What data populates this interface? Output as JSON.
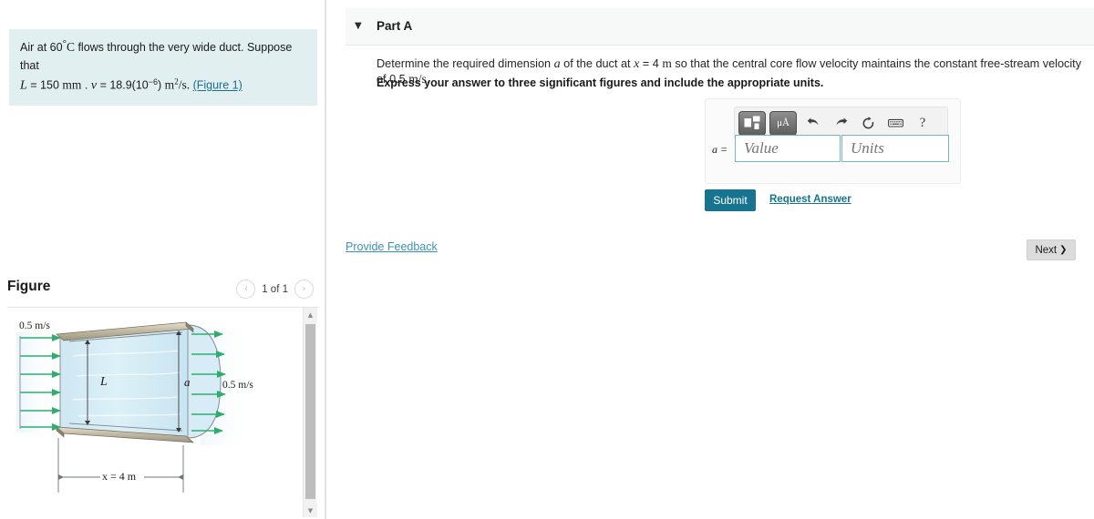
{
  "problem": {
    "line1_a": "Air at 60",
    "line1_deg": "°",
    "line1_c": "C",
    "line1_b": " flows through the very wide duct. Suppose that",
    "var_L": "L",
    "eq1": "= 150",
    "unit_mm": "mm",
    "dot": ".",
    "var_nu": "ν",
    "eq2": "= 18.9(10",
    "exp": "−6",
    "paren": ")",
    "unit_m2s": "m",
    "sup2": "2",
    "per_s": "/s.",
    "figure_link": "(Figure 1)"
  },
  "figure_panel": {
    "title": "Figure",
    "pager_label": "1 of 1",
    "prev_icon": "chevron-left-icon",
    "next_icon": "chevron-right-icon",
    "prev_glyph": "‹",
    "next_glyph": "›",
    "scroll_up_glyph": "▲",
    "scroll_down_glyph": "▼"
  },
  "diagram": {
    "inlet_velocity": "0.5 m/s",
    "outlet_velocity": "0.5 m/s",
    "label_L": "L",
    "label_a": "a",
    "label_x": "x = 4 m",
    "arrow_color": "#2eae6d",
    "fluid_color": "#d8ecf5",
    "wall_color": "#bdb49f"
  },
  "part": {
    "caret_glyph": "▼",
    "caret_icon": "chevron-down-icon",
    "label": "Part A",
    "question": "Determine the required dimension a of the duct at x = 4 m so that the central core flow velocity maintains the constant free-stream velocity of 0.5 m/s.",
    "question_pre": "Determine the required dimension ",
    "question_var_a": "a",
    "question_mid1": " of the duct at ",
    "question_var_x": "x",
    "question_mid2": " = 4 ",
    "question_unit_m": "m",
    "question_mid3": " so that the central core flow velocity maintains the constant free-stream velocity of 0.5 ",
    "question_unit_ms": "m/s",
    "question_end": ".",
    "instruction": "Express your answer to three significant figures and include the appropriate units."
  },
  "answer": {
    "variable": "a =",
    "value_placeholder": "Value",
    "units_placeholder": "Units",
    "value": "",
    "units": "",
    "toolbar": {
      "template_icon": "math-template-icon",
      "units_icon": "micro-angstrom-units-icon",
      "units_label": "μÅ",
      "undo_icon": "undo-arrow-icon",
      "undo_glyph": "↰",
      "redo_icon": "redo-arrow-icon",
      "redo_glyph": "↱",
      "reset_icon": "reset-circular-arrow-icon",
      "reset_glyph": "↺",
      "keyboard_icon": "keyboard-icon",
      "help_icon": "question-mark-help-icon",
      "help_glyph": "?"
    }
  },
  "actions": {
    "submit_label": "Submit",
    "request_answer_label": "Request Answer",
    "provide_feedback_label": "Provide Feedback",
    "next_label": "Next",
    "next_chevron": "❯"
  },
  "colors": {
    "accent_teal": "#16748f",
    "link_blue": "#3b93b5",
    "problem_bg": "#e2eff1",
    "input_border": "#76b5c4"
  }
}
